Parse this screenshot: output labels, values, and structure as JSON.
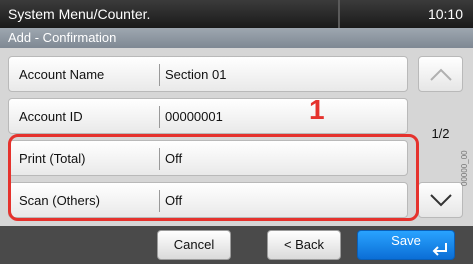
{
  "topbar": {
    "title": "System Menu/Counter.",
    "clock": "10:10"
  },
  "subheader": {
    "title": "Add - Confirmation"
  },
  "rows": [
    {
      "label": "Account Name",
      "value": "Section 01"
    },
    {
      "label": "Account ID",
      "value": "00000001"
    },
    {
      "label": "Print (Total)",
      "value": "Off"
    },
    {
      "label": "Scan (Others)",
      "value": "Off"
    }
  ],
  "scroll": {
    "page_indicator": "1/2",
    "up_icon": "chevron-up-icon",
    "down_icon": "chevron-down-icon"
  },
  "buttons": {
    "cancel": "Cancel",
    "back": "< Back",
    "save": "Save"
  },
  "callout": {
    "number": "1"
  },
  "side_code": "00000_00",
  "colors": {
    "highlight": "#e5322d",
    "save": "#1a8bf0"
  }
}
